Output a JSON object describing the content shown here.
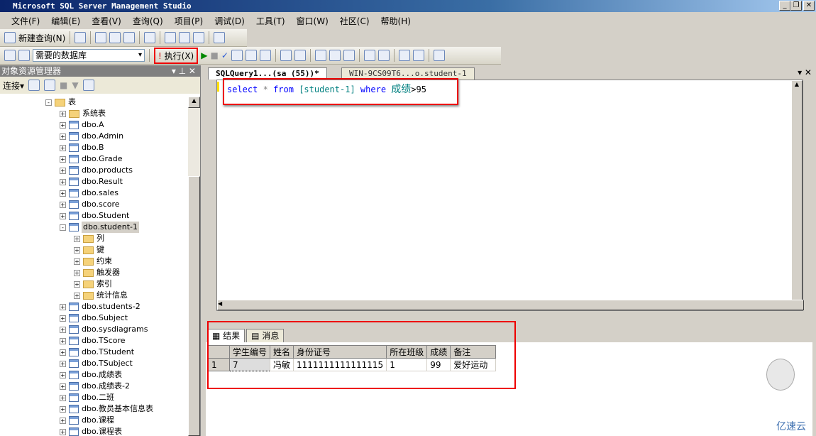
{
  "title": "Microsoft SQL Server Management Studio",
  "menu": [
    "文件(F)",
    "编辑(E)",
    "查看(V)",
    "查询(Q)",
    "项目(P)",
    "调试(D)",
    "工具(T)",
    "窗口(W)",
    "社区(C)",
    "帮助(H)"
  ],
  "toolbar": {
    "new_query": "新建查询(N)",
    "database": "需要的数据库",
    "execute": "执行(X)"
  },
  "object_explorer": {
    "title": "对象资源管理器",
    "connect": "连接",
    "tree": [
      {
        "label": "表",
        "level": 0,
        "icon": "folder",
        "expander": "-"
      },
      {
        "label": "系统表",
        "level": 1,
        "icon": "folder",
        "expander": "+"
      },
      {
        "label": "dbo.A",
        "level": 1,
        "icon": "table",
        "expander": "+"
      },
      {
        "label": "dbo.Admin",
        "level": 1,
        "icon": "table",
        "expander": "+"
      },
      {
        "label": "dbo.B",
        "level": 1,
        "icon": "table",
        "expander": "+"
      },
      {
        "label": "dbo.Grade",
        "level": 1,
        "icon": "table",
        "expander": "+"
      },
      {
        "label": "dbo.products",
        "level": 1,
        "icon": "table",
        "expander": "+"
      },
      {
        "label": "dbo.Result",
        "level": 1,
        "icon": "table",
        "expander": "+"
      },
      {
        "label": "dbo.sales",
        "level": 1,
        "icon": "table",
        "expander": "+"
      },
      {
        "label": "dbo.score",
        "level": 1,
        "icon": "table",
        "expander": "+"
      },
      {
        "label": "dbo.Student",
        "level": 1,
        "icon": "table",
        "expander": "+"
      },
      {
        "label": "dbo.student-1",
        "level": 1,
        "icon": "table",
        "expander": "-",
        "selected": true
      },
      {
        "label": "列",
        "level": 2,
        "icon": "folder",
        "expander": "+"
      },
      {
        "label": "键",
        "level": 2,
        "icon": "folder",
        "expander": "+"
      },
      {
        "label": "约束",
        "level": 2,
        "icon": "folder",
        "expander": "+"
      },
      {
        "label": "触发器",
        "level": 2,
        "icon": "folder",
        "expander": "+"
      },
      {
        "label": "索引",
        "level": 2,
        "icon": "folder",
        "expander": "+"
      },
      {
        "label": "统计信息",
        "level": 2,
        "icon": "folder",
        "expander": "+"
      },
      {
        "label": "dbo.students-2",
        "level": 1,
        "icon": "table",
        "expander": "+"
      },
      {
        "label": "dbo.Subject",
        "level": 1,
        "icon": "table",
        "expander": "+"
      },
      {
        "label": "dbo.sysdiagrams",
        "level": 1,
        "icon": "table",
        "expander": "+"
      },
      {
        "label": "dbo.TScore",
        "level": 1,
        "icon": "table",
        "expander": "+"
      },
      {
        "label": "dbo.TStudent",
        "level": 1,
        "icon": "table",
        "expander": "+"
      },
      {
        "label": "dbo.TSubject",
        "level": 1,
        "icon": "table",
        "expander": "+"
      },
      {
        "label": "dbo.成绩表",
        "level": 1,
        "icon": "table",
        "expander": "+"
      },
      {
        "label": "dbo.成绩表-2",
        "level": 1,
        "icon": "table",
        "expander": "+"
      },
      {
        "label": "dbo.二班",
        "level": 1,
        "icon": "table",
        "expander": "+"
      },
      {
        "label": "dbo.教员基本信息表",
        "level": 1,
        "icon": "table",
        "expander": "+"
      },
      {
        "label": "dbo.课程",
        "level": 1,
        "icon": "table",
        "expander": "+"
      },
      {
        "label": "dbo.课程表",
        "level": 1,
        "icon": "table",
        "expander": "+"
      }
    ]
  },
  "tabs": [
    {
      "label": "SQLQuery1...(sa (55))*",
      "active": true
    },
    {
      "label": "WIN-9CS09T6...o.student-1",
      "active": false
    }
  ],
  "query": {
    "select": "select",
    "star": "*",
    "from": "from",
    "table": "[student-1]",
    "where": "where",
    "column": "成绩",
    "op": ">95"
  },
  "results": {
    "tabs": [
      "结果",
      "消息"
    ],
    "columns": [
      "学生编号",
      "姓名",
      "身份证号",
      "所在班级",
      "成绩",
      "备注"
    ],
    "rows": [
      {
        "num": "1",
        "cells": [
          "7",
          "冯敏",
          "1111111111111115",
          "1",
          "99",
          "爱好运动"
        ]
      }
    ]
  },
  "watermark": "亿速云",
  "colors": {
    "highlight": "#e00000",
    "keyword": "#0000ff",
    "identifier": "#008080"
  }
}
